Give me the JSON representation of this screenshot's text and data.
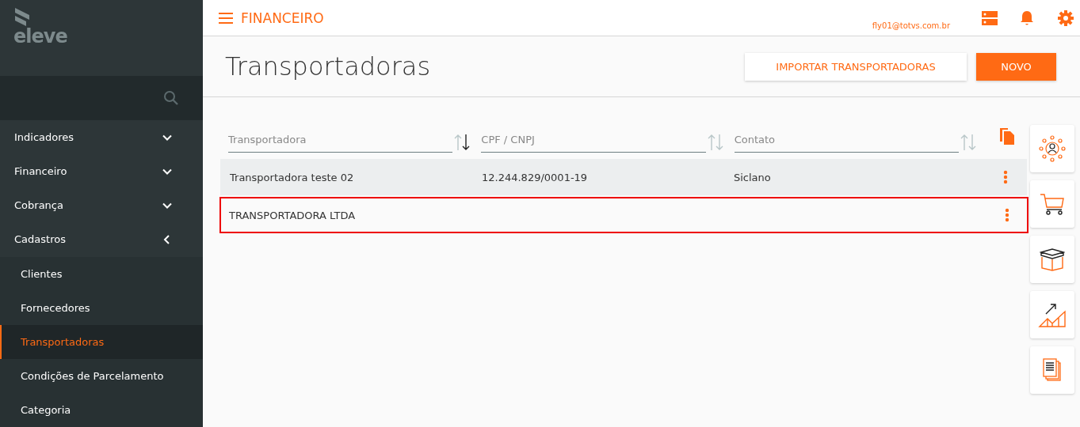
{
  "logo": {
    "text": "eleve"
  },
  "sidebar": {
    "items": [
      {
        "label": "Indicadores",
        "expanded": false
      },
      {
        "label": "Financeiro",
        "expanded": false
      },
      {
        "label": "Cobrança",
        "expanded": false
      },
      {
        "label": "Cadastros",
        "expanded": true,
        "children": [
          {
            "label": "Clientes",
            "selected": false
          },
          {
            "label": "Fornecedores",
            "selected": false
          },
          {
            "label": "Transportadoras",
            "selected": true
          },
          {
            "label": "Condições de Parcelamento",
            "selected": false
          },
          {
            "label": "Categoria",
            "selected": false
          }
        ]
      }
    ]
  },
  "topbar": {
    "module": "FINANCEIRO",
    "user": "fly01@totvs.com.br"
  },
  "page": {
    "title": "Transportadoras",
    "buttons": [
      {
        "label": "IMPORTAR TRANSPORTADORAS",
        "kind": "secondary"
      },
      {
        "label": "NOVO",
        "kind": "primary"
      }
    ]
  },
  "table": {
    "columns": [
      {
        "label": "Transportadora",
        "sorted": true
      },
      {
        "label": "CPF / CNPJ",
        "sorted": false
      },
      {
        "label": "Contato",
        "sorted": false
      }
    ],
    "rows": [
      {
        "cells": [
          "Transportadora teste 02",
          "12.244.829/0001-19",
          "Siclano"
        ],
        "shaded": true,
        "outlined": false
      },
      {
        "cells": [
          "TRANSPORTADORA LTDA",
          null,
          null
        ],
        "shaded": false,
        "outlined": true
      }
    ]
  }
}
